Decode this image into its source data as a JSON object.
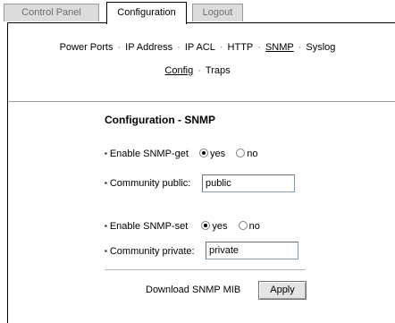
{
  "tabs": {
    "control_panel": "Control Panel",
    "configuration": "Configuration",
    "logout": "Logout"
  },
  "nav": {
    "primary": [
      "Power Ports",
      "IP Address",
      "IP ACL",
      "HTTP",
      "SNMP",
      "Syslog"
    ],
    "primary_current": "SNMP",
    "secondary": [
      "Config",
      "Traps"
    ],
    "secondary_current": "Config",
    "separator": "·"
  },
  "form": {
    "title": "Configuration - SNMP",
    "bullet": "▪",
    "snmp_get_label": "Enable SNMP-get",
    "snmp_get_value": "yes",
    "community_public_label": "Community public:",
    "community_public_value": "public",
    "snmp_set_label": "Enable SNMP-set",
    "snmp_set_value": "yes",
    "community_private_label": "Community private:",
    "community_private_value": "private",
    "yes_label": "yes",
    "no_label": "no"
  },
  "footer": {
    "download_label": "Download SNMP MIB",
    "apply_label": "Apply"
  }
}
